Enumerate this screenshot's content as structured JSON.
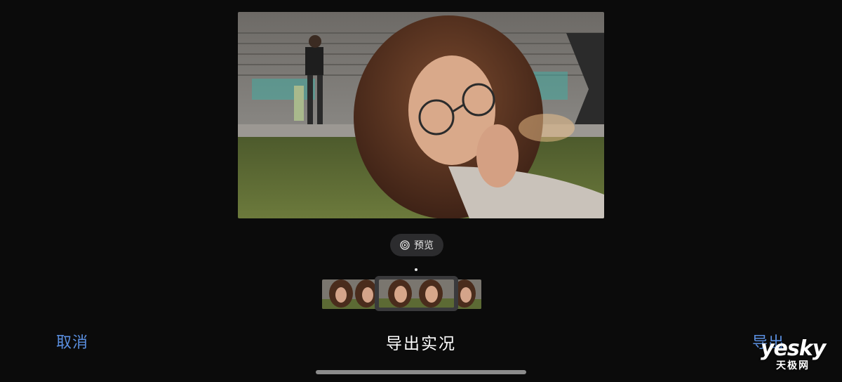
{
  "photo": {
    "description_label": "live-photo-frame"
  },
  "preview": {
    "label": "预览",
    "icon": "play-circle-icon"
  },
  "filmstrip": {
    "selected_index": 2,
    "frame_count": 5
  },
  "bottom_bar": {
    "cancel_label": "取消",
    "title": "导出实况",
    "export_label": "导出"
  },
  "watermark": {
    "brand_en": "yesky",
    "brand_cn": "天极网"
  },
  "colors": {
    "background": "#0b0b0b",
    "accent": "#5a8fe0",
    "pill": "#2c2c2e"
  }
}
